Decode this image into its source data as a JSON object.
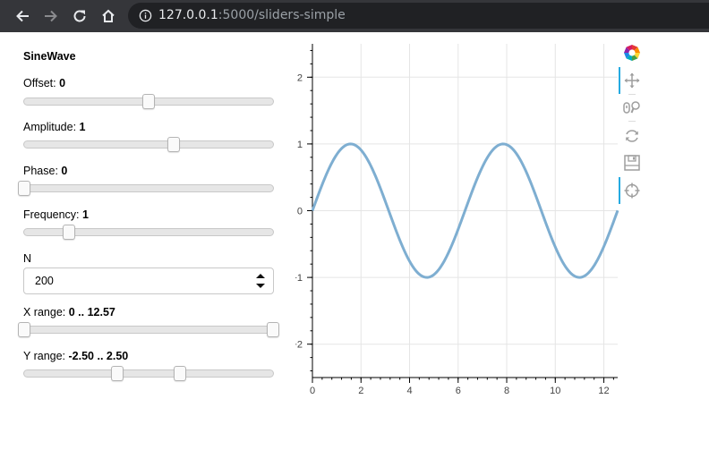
{
  "browser": {
    "url_host": "127.0.0.1",
    "url_path": ":5000/sliders-simple"
  },
  "panel": {
    "title": "SineWave",
    "offset": {
      "label": "Offset:",
      "value": "0",
      "min": -5,
      "max": 5,
      "current": 0
    },
    "amplitude": {
      "label": "Amplitude:",
      "value": "1",
      "min": -5,
      "max": 5,
      "current": 1
    },
    "phase": {
      "label": "Phase:",
      "value": "0",
      "min": 0,
      "max": 6.3,
      "current": 0
    },
    "frequency": {
      "label": "Frequency:",
      "value": "1",
      "min": 0.1,
      "max": 5.1,
      "current": 1
    },
    "n": {
      "label": "N",
      "value": "200"
    },
    "x_range": {
      "label": "X range:",
      "value": "0 .. 12.57",
      "low": 0,
      "high": 12.57,
      "min": 0,
      "max": 12.57
    },
    "y_range": {
      "label": "Y range:",
      "value": "-2.50 .. 2.50",
      "low": -2.5,
      "high": 2.5,
      "min": -10,
      "max": 10
    }
  },
  "toolbar": {
    "tools": [
      "bokeh-logo-icon",
      "pan-icon",
      "wheel-zoom-icon",
      "reset-icon",
      "save-icon",
      "hover-icon"
    ]
  },
  "chart_data": {
    "type": "line",
    "function": "offset + amplitude * sin(frequency * x + phase)",
    "xlim": [
      0,
      12.57
    ],
    "ylim": [
      -2.5,
      2.5
    ],
    "x_ticks": [
      "0",
      "2",
      "4",
      "6",
      "8",
      "10",
      "12"
    ],
    "y_ticks": [
      "−2",
      "−1",
      "0",
      "1",
      "2"
    ],
    "y_tick_values": [
      -2,
      -1,
      0,
      1,
      2
    ],
    "x_tick_values": [
      0,
      2,
      4,
      6,
      8,
      10,
      12
    ],
    "grid": true,
    "line_color": "#7eaed1"
  }
}
